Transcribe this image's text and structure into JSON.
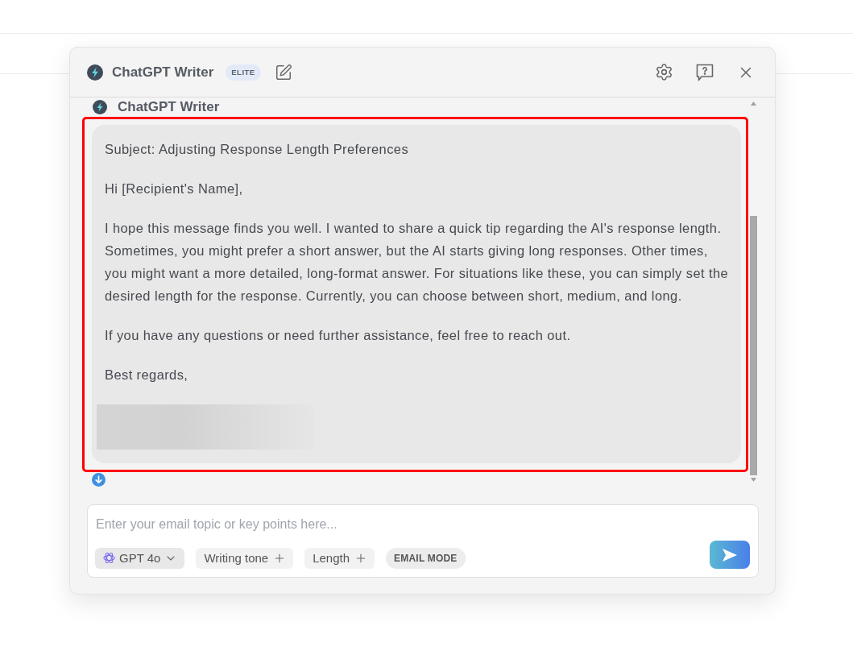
{
  "header": {
    "title": "ChatGPT Writer",
    "badge": "ELITE"
  },
  "thread": {
    "messages": [
      {
        "sender": "ChatGPT Writer",
        "highlighted": true,
        "paragraphs": [
          "Subject: Adjusting Response Length Preferences",
          "Hi [Recipient's Name],",
          "I hope this message finds you well. I wanted to share a quick tip regarding the AI's response length. Sometimes, you might prefer a short answer, but the AI starts giving long responses. Other times, you might want a more detailed, long-format answer. For situations like these, you can simply set the desired length for the response. Currently, you can choose between short, medium, and long.",
          "If you have any questions or need further assistance, feel free to reach out.",
          "Best regards,"
        ],
        "signature_redacted": true
      }
    ]
  },
  "composer": {
    "placeholder": "Enter your email topic or key points here...",
    "chips": [
      {
        "kind": "model",
        "label": "GPT 4o"
      },
      {
        "kind": "add",
        "label": "Writing tone"
      },
      {
        "kind": "add",
        "label": "Length"
      },
      {
        "kind": "mode",
        "label": "EMAIL MODE"
      }
    ]
  }
}
